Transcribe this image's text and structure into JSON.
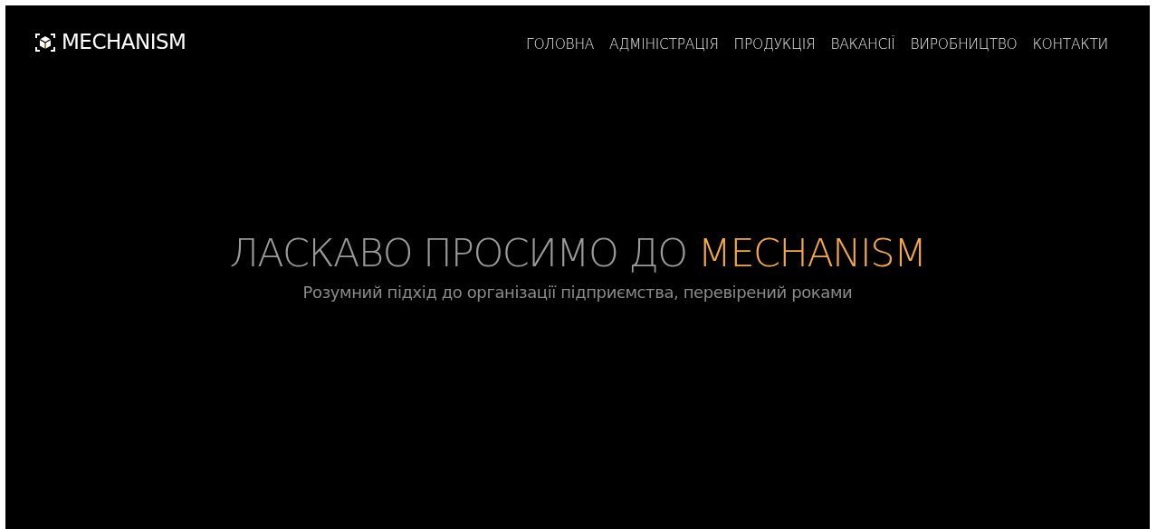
{
  "logo": {
    "text": "MECHANISM"
  },
  "nav": [
    {
      "label": "ГОЛОВНА"
    },
    {
      "label": "АДМІНІСТРАЦІЯ"
    },
    {
      "label": "ПРОДУКЦІЯ"
    },
    {
      "label": "ВАКАНСІЇ"
    },
    {
      "label": "ВИРОБНИЦТВО"
    },
    {
      "label": "КОНТАКТИ"
    }
  ],
  "hero": {
    "title": "ЛАСКАВО ПРОСИМО ДО",
    "title_highlight": "MECHANISM",
    "subtitle": "Розумний підхід до організації підприємства, перевірений роками"
  }
}
